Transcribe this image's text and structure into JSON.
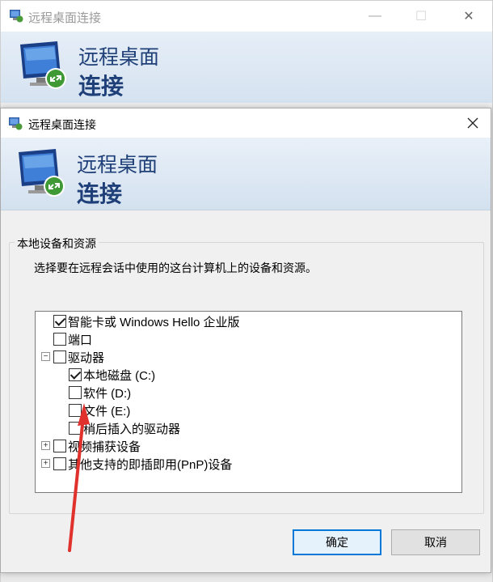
{
  "background_window": {
    "title": "远程桌面连接",
    "banner_line1": "远程桌面",
    "banner_line2": "连接",
    "controls": {
      "minimize": "—",
      "maximize": "☐",
      "close": "✕"
    }
  },
  "dialog": {
    "title": "远程桌面连接",
    "close_glyph": "✕",
    "banner_line1": "远程桌面",
    "banner_line2": "连接",
    "group": {
      "legend": "本地设备和资源",
      "description": "选择要在远程会话中使用的这台计算机上的设备和资源。"
    },
    "tree": [
      {
        "label": "智能卡或 Windows Hello 企业版",
        "checked": true,
        "level": 0,
        "expander": ""
      },
      {
        "label": "端口",
        "checked": false,
        "level": 0,
        "expander": ""
      },
      {
        "label": "驱动器",
        "checked": false,
        "level": 0,
        "expander": "−"
      },
      {
        "label": "本地磁盘 (C:)",
        "checked": true,
        "level": 1,
        "expander": ""
      },
      {
        "label": "软件 (D:)",
        "checked": false,
        "level": 1,
        "expander": ""
      },
      {
        "label": "文件 (E:)",
        "checked": false,
        "level": 1,
        "expander": ""
      },
      {
        "label": "稍后插入的驱动器",
        "checked": false,
        "level": 1,
        "expander": ""
      },
      {
        "label": "视频捕获设备",
        "checked": false,
        "level": 0,
        "expander": "+"
      },
      {
        "label": "其他支持的即插即用(PnP)设备",
        "checked": false,
        "level": 0,
        "expander": "+"
      }
    ],
    "buttons": {
      "ok": "确定",
      "cancel": "取消"
    }
  },
  "colors": {
    "banner_text": "#1f3f78",
    "annotation_arrow": "#e0312c",
    "default_button_border": "#0078d7"
  },
  "icons": {
    "app": "remote-desktop-icon",
    "banner": "remote-desktop-monitor-icon"
  }
}
